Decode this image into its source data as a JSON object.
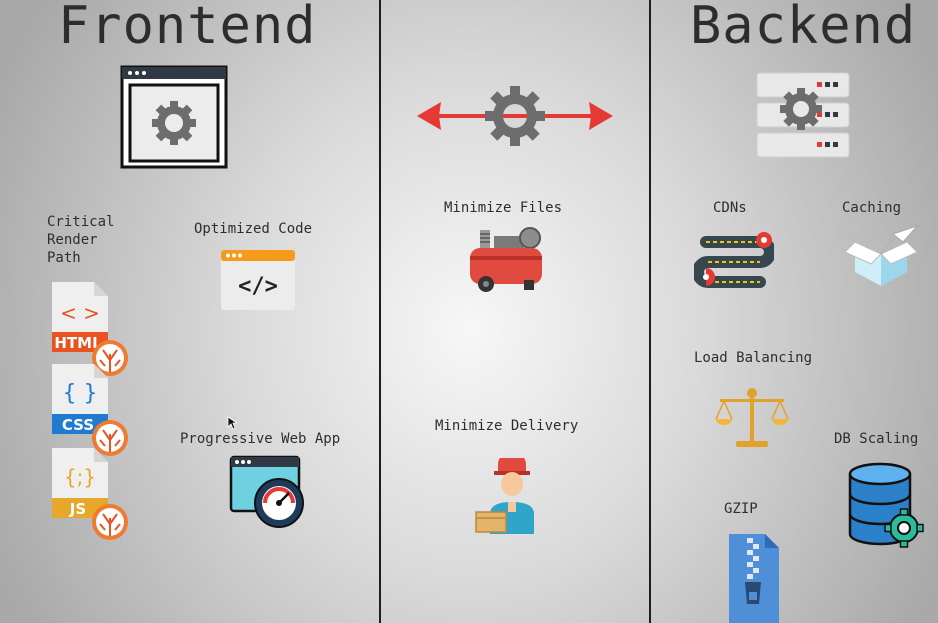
{
  "frontend": {
    "title": "Frontend",
    "critical_render_path": "Critical\nRender\nPath",
    "optimized_code": "Optimized Code",
    "progressive_web_app": "Progressive Web App",
    "file_badges": {
      "html": "HTML",
      "css": "CSS",
      "js": "JS"
    },
    "file_glyphs": {
      "html": "< >",
      "css": "{ }",
      "js": "{;}"
    }
  },
  "middle": {
    "minimize_files": "Minimize Files",
    "minimize_delivery": "Minimize Delivery"
  },
  "backend": {
    "title": "Backend",
    "cdns": "CDNs",
    "caching": "Caching",
    "load_balancing": "Load Balancing",
    "db_scaling": "DB Scaling",
    "gzip": "GZIP"
  },
  "code_glyph": "</>",
  "colors": {
    "arrow_red": "#e53935",
    "gear_gray": "#6d6d6d",
    "html_orange": "#e8531f",
    "css_blue": "#1f7bd1",
    "js_yellow": "#e7a72a",
    "compressor_red": "#e04a3f"
  }
}
